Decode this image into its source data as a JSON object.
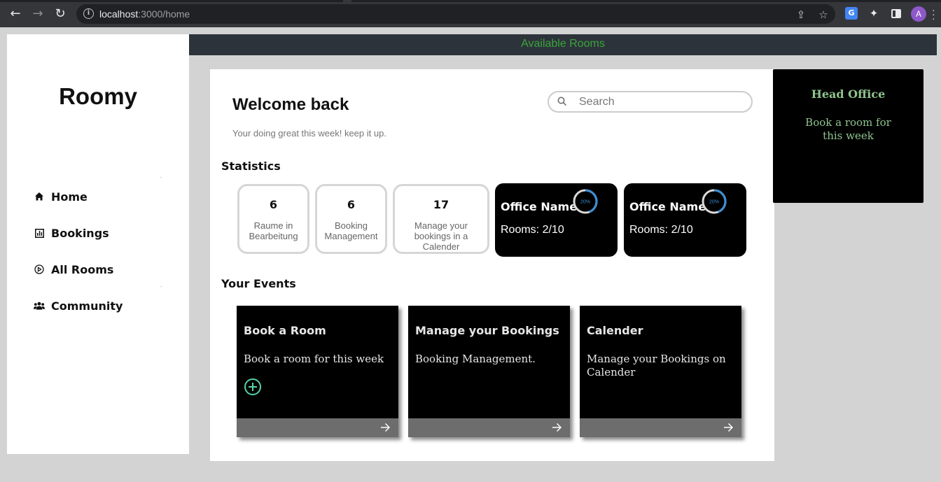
{
  "browser": {
    "url_host": "localhost",
    "url_rest": ":3000/home",
    "profile_initial": "A",
    "translate_icon_text": "G"
  },
  "app": {
    "brand": "Roomy",
    "banner": "Available Rooms"
  },
  "sidebar": {
    "items": [
      {
        "label": "Home",
        "icon": "home-icon"
      },
      {
        "label": "Bookings",
        "icon": "chart-icon"
      },
      {
        "label": "All Rooms",
        "icon": "play-circle-icon"
      },
      {
        "label": "Community",
        "icon": "users-icon"
      }
    ]
  },
  "main": {
    "welcome": "Welcome back",
    "subtext": "Your doing great this week! keep it up.",
    "search_placeholder": "Search",
    "statistics_title": "Statistics",
    "events_title": "Your Events"
  },
  "stats": [
    {
      "value": "6",
      "label": "Raume in Bearbeitung"
    },
    {
      "value": "6",
      "label": "Booking Management"
    },
    {
      "value": "17",
      "label": "Manage your bookings in a Calender"
    }
  ],
  "offices": [
    {
      "name": "Office Name",
      "rooms": "Rooms: 2/10",
      "percent_label": "20%",
      "percent": 20
    },
    {
      "name": "Office Name",
      "rooms": "Rooms: 2/10",
      "percent_label": "20%",
      "percent": 20
    }
  ],
  "events": [
    {
      "title": "Book a Room",
      "desc": "Book a room for this week",
      "has_add": true
    },
    {
      "title": "Manage your Bookings",
      "desc": "Booking Management.",
      "has_add": false
    },
    {
      "title": "Calender",
      "desc": "Manage your Bookings on Calender",
      "has_add": false
    }
  ],
  "right_panel": {
    "title": "Head Office",
    "desc": "Book a room for this week"
  },
  "colors": {
    "banner_bg": "#2d333b",
    "banner_text": "#3aa63a",
    "panel_text": "#8fc48f",
    "accent_ring": "#3b8fd8",
    "add_icon": "#57d3a6"
  }
}
